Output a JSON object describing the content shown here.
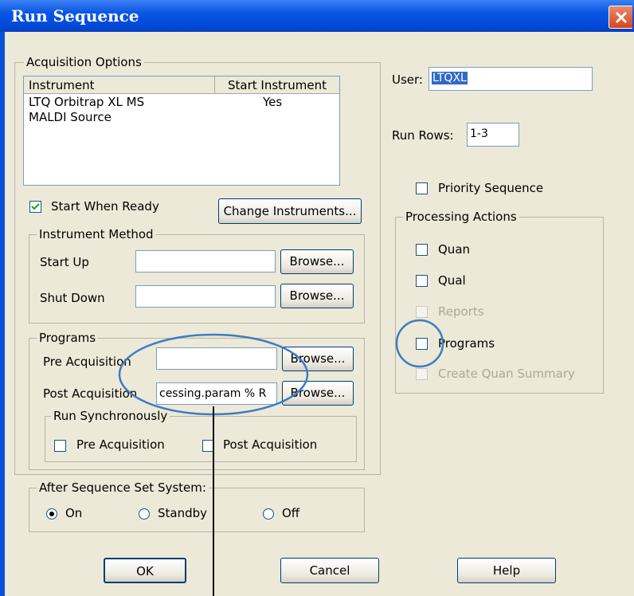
{
  "window": {
    "title": "Run Sequence"
  },
  "acquisition": {
    "legend": "Acquisition Options",
    "columns": [
      "Instrument",
      "Start Instrument"
    ],
    "rows": [
      {
        "instrument": "LTQ Orbitrap XL MS",
        "start": "Yes"
      },
      {
        "instrument": "MALDI Source",
        "start": ""
      }
    ],
    "start_when_ready": {
      "label": "Start When Ready",
      "checked": true
    },
    "change_instruments_label": "Change Instruments..."
  },
  "instrument_method": {
    "legend": "Instrument Method",
    "start_up": {
      "label": "Start Up",
      "value": "",
      "browse": "Browse..."
    },
    "shut_down": {
      "label": "Shut Down",
      "value": "",
      "browse": "Browse..."
    }
  },
  "programs": {
    "legend": "Programs",
    "pre": {
      "label": "Pre Acquisition",
      "value": "",
      "browse": "Browse..."
    },
    "post": {
      "label": "Post Acquisition",
      "value": "cessing.param % R",
      "browse": "Browse..."
    },
    "run_sync": {
      "legend": "Run Synchronously",
      "pre_label": "Pre Acquisition",
      "post_label": "Post Acquisition"
    }
  },
  "after_sequence": {
    "legend": "After Sequence Set System:",
    "options": [
      "On",
      "Standby",
      "Off"
    ],
    "selected": "On"
  },
  "user": {
    "label": "User:",
    "value": "LTQXL"
  },
  "run_rows": {
    "label": "Run Rows:",
    "value": "1-3"
  },
  "priority_sequence": {
    "label": "Priority Sequence",
    "checked": false
  },
  "processing": {
    "legend": "Processing Actions",
    "items": [
      {
        "label": "Quan",
        "enabled": true
      },
      {
        "label": "Qual",
        "enabled": true
      },
      {
        "label": "Reports",
        "enabled": false
      },
      {
        "label": "Programs",
        "enabled": true
      },
      {
        "label": "Create Quan Summary",
        "enabled": false
      }
    ]
  },
  "buttons": {
    "ok": "OK",
    "cancel": "Cancel",
    "help": "Help"
  },
  "colors": {
    "titlebar": "#0a56e4",
    "highlight": "#316ac5",
    "callout": "#3c7cc4"
  }
}
